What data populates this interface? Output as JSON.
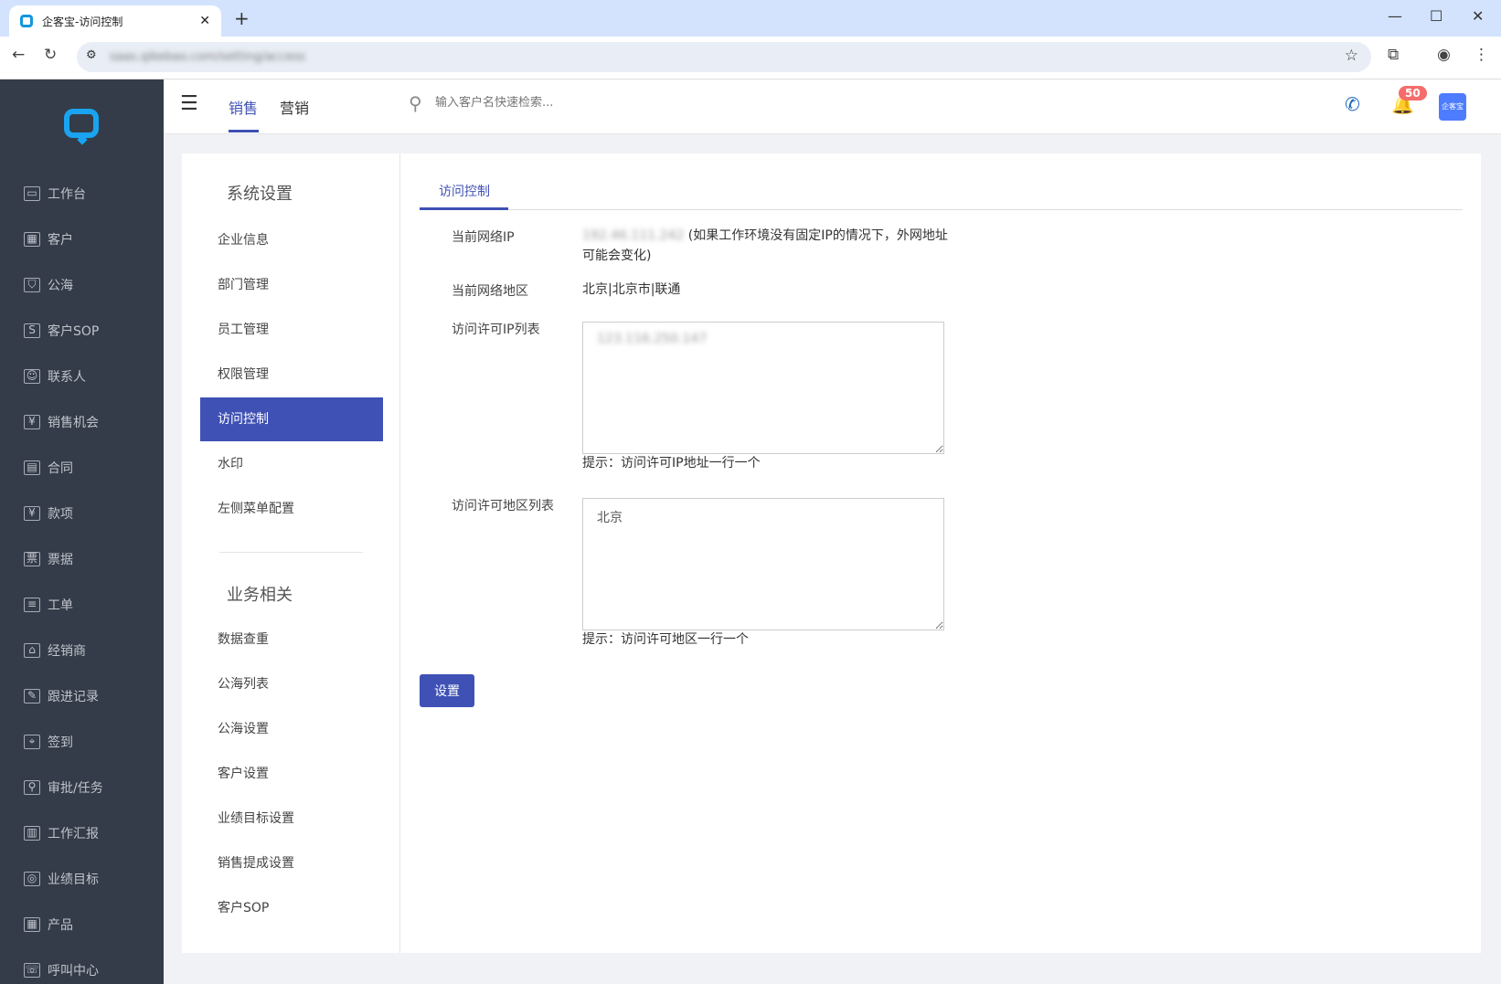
{
  "browser": {
    "tab_title": "企客宝-访问控制",
    "url": "saas.qikebao.com/setting/access"
  },
  "sidebar": {
    "items": [
      {
        "label": "工作台",
        "icon": "monitor-icon",
        "glyph": "▭"
      },
      {
        "label": "客户",
        "icon": "building-icon",
        "glyph": "▦"
      },
      {
        "label": "公海",
        "icon": "basket-icon",
        "glyph": "⛉"
      },
      {
        "label": "客户SOP",
        "icon": "sop-icon",
        "glyph": "S"
      },
      {
        "label": "联系人",
        "icon": "contacts-icon",
        "glyph": "☺"
      },
      {
        "label": "销售机会",
        "icon": "money-bag-icon",
        "glyph": "¥"
      },
      {
        "label": "合同",
        "icon": "contract-icon",
        "glyph": "▤"
      },
      {
        "label": "款项",
        "icon": "payment-icon",
        "glyph": "¥"
      },
      {
        "label": "票据",
        "icon": "invoice-icon",
        "glyph": "票"
      },
      {
        "label": "工单",
        "icon": "clipboard-icon",
        "glyph": "≡"
      },
      {
        "label": "经销商",
        "icon": "store-icon",
        "glyph": "⌂"
      },
      {
        "label": "跟进记录",
        "icon": "edit-icon",
        "glyph": "✎"
      },
      {
        "label": "签到",
        "icon": "location-icon",
        "glyph": "⌖"
      },
      {
        "label": "审批/任务",
        "icon": "stamp-icon",
        "glyph": "⚲"
      },
      {
        "label": "工作汇报",
        "icon": "report-icon",
        "glyph": "▥"
      },
      {
        "label": "业绩目标",
        "icon": "target-icon",
        "glyph": "◎"
      },
      {
        "label": "产品",
        "icon": "grid-icon",
        "glyph": "▦"
      },
      {
        "label": "呼叫中心",
        "icon": "phone-icon",
        "glyph": "☏"
      }
    ]
  },
  "header": {
    "tabs": [
      "销售",
      "营销"
    ],
    "search_placeholder": "输入客户名快速检索...",
    "notification_count": "50",
    "avatar_text": "企客宝"
  },
  "settings_nav": {
    "section1": "系统设置",
    "items1": [
      "企业信息",
      "部门管理",
      "员工管理",
      "权限管理",
      "访问控制",
      "水印",
      "左侧菜单配置"
    ],
    "section2": "业务相关",
    "items2": [
      "数据查重",
      "公海列表",
      "公海设置",
      "客户设置",
      "业绩目标设置",
      "销售提成设置",
      "客户SOP"
    ]
  },
  "main": {
    "tab": "访问控制",
    "current_ip_label": "当前网络IP",
    "current_ip": "192.46.111.242",
    "current_ip_note": " (如果工作环境没有固定IP的情况下，外网地址",
    "current_ip_note2": "可能会变化)",
    "region_label": "当前网络地区",
    "region": "北京|北京市|联通",
    "ip_list_label": "访问许可IP列表",
    "ip_list": "123.116.250.147",
    "ip_hint": "提示：访问许可IP地址一行一个",
    "region_list_label": "访问许可地区列表",
    "region_list": "北京",
    "region_hint": "提示：访问许可地区一行一个",
    "submit": "设置"
  },
  "colors": {
    "accent": "#3f51b5",
    "sidebar": "#333c48",
    "badge": "#f56c6c"
  }
}
